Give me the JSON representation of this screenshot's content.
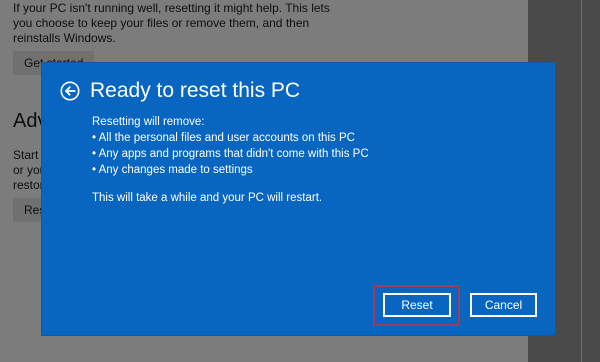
{
  "background": {
    "intro_text": "If your PC isn't running well, resetting it might help. This lets you choose to keep your files or remove them, and then reinstalls Windows.",
    "get_started_label": "Get started",
    "advanced_heading": "Adv",
    "advanced_text": "Start c\nor your I\nrestor",
    "restart_button_label": "Res"
  },
  "dialog": {
    "title": "Ready to reset this PC",
    "removal_heading": "Resetting will remove:",
    "removal_items": [
      "All the personal files and user accounts on this PC",
      "Any apps and programs that didn't come with this PC",
      "Any changes made to settings"
    ],
    "restart_note": "This will take a while and your PC will restart.",
    "reset_label": "Reset",
    "cancel_label": "Cancel"
  },
  "colors": {
    "dialog_background": "#0966c0",
    "highlight_border": "#a23a5a"
  },
  "icons": {
    "back": "back-arrow-circle-icon"
  }
}
